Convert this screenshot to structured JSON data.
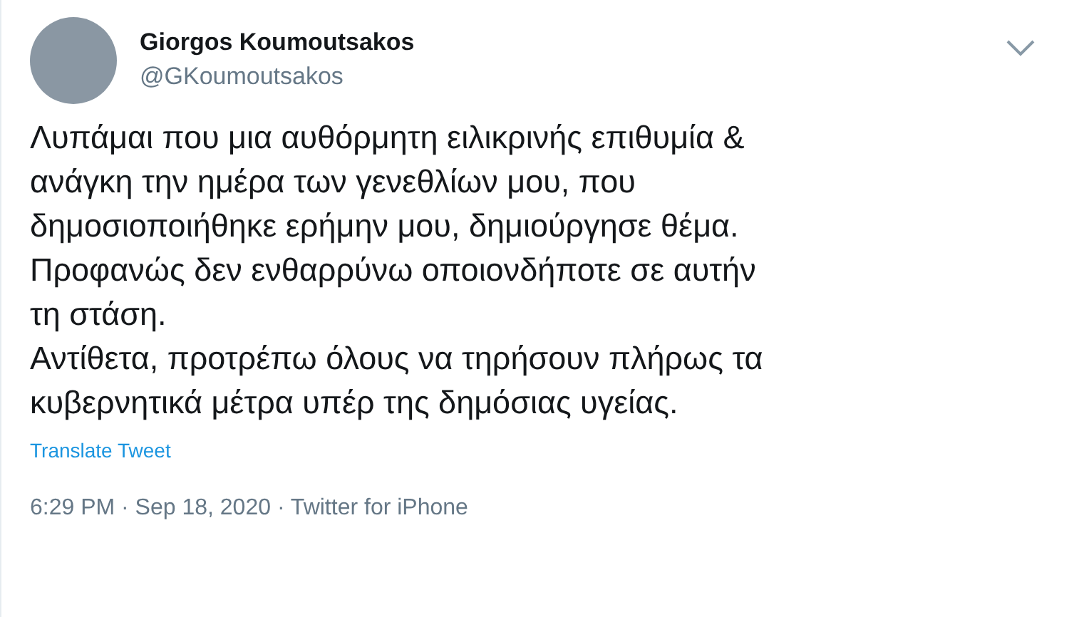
{
  "author": {
    "name": "Giorgos Koumoutsakos",
    "handle": "@GKoumoutsakos"
  },
  "tweet_lines": [
    "Λυπάμαι που μια αυθόρμητη ειλικρινής επιθυμία &",
    "ανάγκη την ημέρα των γενεθλίων μου, που",
    "δημοσιοποιήθηκε ερήμην μου, δημιούργησε θέμα.",
    "Προφανώς δεν ενθαρρύνω οποιονδήποτε σε αυτήν",
    "τη στάση.",
    "Αντίθετα, προτρέπω όλους να τηρήσουν πλήρως τα",
    "κυβερνητικά μέτρα υπέρ της δημόσιας υγείας."
  ],
  "translate_link": "Translate Tweet",
  "meta": "6:29 PM · Sep 18, 2020 · Twitter for iPhone"
}
